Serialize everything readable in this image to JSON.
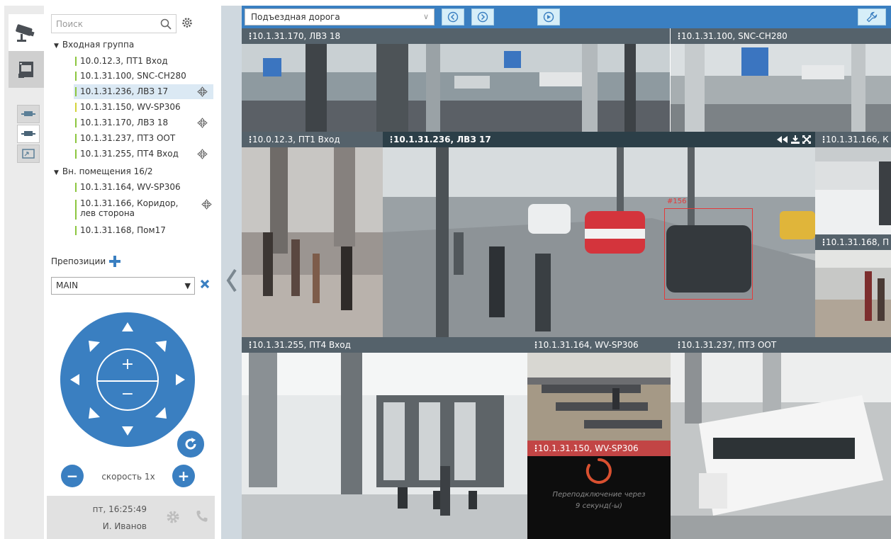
{
  "search": {
    "placeholder": "Поиск"
  },
  "tree": {
    "groups": [
      {
        "label": "Входная группа"
      },
      {
        "label": "Вн. помещения 16/2"
      }
    ],
    "cameras": [
      {
        "label": "10.0.12.3, ПТ1 Вход"
      },
      {
        "label": "10.1.31.100, SNC-CH280"
      },
      {
        "label": "10.1.31.236, ЛВЗ 17"
      },
      {
        "label": "10.1.31.150, WV-SP306"
      },
      {
        "label": "10.1.31.170, ЛВЗ 18"
      },
      {
        "label": "10.1.31.237, ПТ3 ООТ"
      },
      {
        "label": "10.1.31.255, ПТ4 Вход"
      },
      {
        "label": "10.1.31.164, WV-SP306"
      },
      {
        "label": "10.1.31.166, Коридор, лев сторона"
      },
      {
        "label": "10.1.31.168, Пом17"
      }
    ]
  },
  "presets": {
    "label": "Препозиции",
    "selected": "MAIN"
  },
  "ptz": {
    "zoom_in": "+",
    "zoom_out": "−",
    "speed_label": "скорость 1x",
    "speed_minus": "−",
    "speed_plus": "+"
  },
  "footer": {
    "clock": "пт, 16:25:49",
    "user": "И. Иванов"
  },
  "viewer": {
    "layout": "Подъездная дорога",
    "tiles": [
      {
        "title": "10.1.31.170, ЛВЗ 18"
      },
      {
        "title": "10.1.31.100, SNC-CH280"
      },
      {
        "title": "10.0.12.3, ПТ1 Вход"
      },
      {
        "title": "10.1.31.236, ЛВЗ 17"
      },
      {
        "title": "10.1.31.166, К"
      },
      {
        "title": "10.1.31.168, П"
      },
      {
        "title": "10.1.31.255, ПТ4 Вход"
      },
      {
        "title": "10.1.31.164, WV-SP306"
      },
      {
        "title": "10.1.31.237, ПТ3 ООТ"
      },
      {
        "title": "10.1.31.150, WV-SP306"
      }
    ],
    "detection_label": "#156",
    "reconnect_text": "Переподключение через\n9 секунд(-ы)"
  },
  "colors": {
    "accent": "#3a7fc1",
    "tile_header": "#55626b",
    "active_header": "#2c3f48",
    "error_header": "#c24545",
    "detection": "#e43a3a",
    "status_green": "#8cc63f"
  },
  "icons": [
    "camera-icon",
    "archive-icon",
    "layout-icon",
    "search-icon",
    "settings-icon",
    "ptz-icon",
    "plus-icon",
    "close-icon",
    "refresh-icon",
    "gear-icon",
    "phone-icon",
    "wrench-icon",
    "chevron-left-icon",
    "arrow-left-circle-icon",
    "arrow-right-circle-icon",
    "play-circle-icon"
  ]
}
